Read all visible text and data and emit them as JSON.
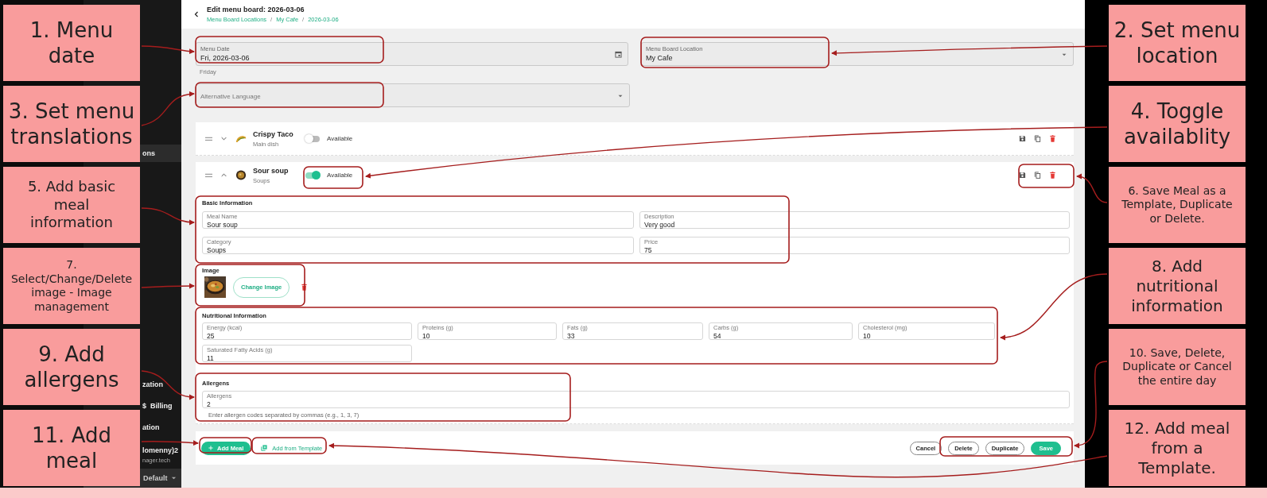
{
  "left_notes": [
    {
      "text": "1. Menu\ndate"
    },
    {
      "text": "3. Set menu\ntranslations"
    },
    {
      "text": "5. Add basic\nmeal\ninformation"
    },
    {
      "text": "7.\nSelect/Change/Delete\nimage - Image\nmanagement"
    },
    {
      "text": "9. Add\nallergens"
    },
    {
      "text": "11. Add\nmeal"
    }
  ],
  "right_notes": [
    {
      "text": "2. Set menu\nlocation"
    },
    {
      "text": "4. Toggle\navailablity"
    },
    {
      "text": "6. Save Meal as a\nTemplate, Duplicate\nor Delete."
    },
    {
      "text": "8. Add\nnutritional\ninformation"
    },
    {
      "text": "10. Save, Delete,\nDuplicate or Cancel\nthe entire day"
    },
    {
      "text": "12. Add meal\nfrom a\nTemplate."
    }
  ],
  "sidebar": {
    "items": [
      {
        "label": "ons",
        "selected": true
      },
      {
        "label": "zation",
        "selected": false
      },
      {
        "icon_text": "$",
        "label": "Billing",
        "selected": false
      },
      {
        "label": "ation",
        "selected": false
      }
    ],
    "account": {
      "name": "lomenny)2",
      "email": "nager.tech"
    },
    "workspace_select": {
      "value": "Default"
    }
  },
  "header": {
    "title": "Edit menu board: 2026-03-06",
    "breadcrumbs": [
      "Menu Board Locations",
      "My Cafe",
      "2026-03-06"
    ],
    "separator": "/"
  },
  "form": {
    "menu_date": {
      "label": "Menu Date",
      "value": "Fri, 2026-03-06",
      "hint": "Friday"
    },
    "location": {
      "label": "Menu Board Location",
      "value": "My Cafe"
    },
    "alternative_language": {
      "placeholder": "Alternative Language"
    }
  },
  "meals": [
    {
      "name": "Crispy Taco",
      "category": "Main dish",
      "availability_label": "Available",
      "available": false,
      "expanded": false
    },
    {
      "name": "Sour soup",
      "category": "Soups",
      "availability_label": "Available",
      "available": true,
      "expanded": true,
      "details": {
        "basic_title": "Basic Information",
        "basic_fields": [
          {
            "label": "Meal Name",
            "value": "Sour soup"
          },
          {
            "label": "Description",
            "value": "Very good"
          },
          {
            "label": "Category",
            "value": "Soups"
          },
          {
            "label": "Price",
            "value": "75"
          }
        ],
        "image_title": "Image",
        "change_image": "Change Image",
        "nutrition_title": "Nutritional Information",
        "nutrition_fields": [
          {
            "label": "Energy (kcal)",
            "value": "25"
          },
          {
            "label": "Proteins (g)",
            "value": "10"
          },
          {
            "label": "Fats (g)",
            "value": "33"
          },
          {
            "label": "Carbs (g)",
            "value": "54"
          },
          {
            "label": "Cholesterol (mg)",
            "value": "10"
          },
          {
            "label": "Saturated Fatty Acids (g)",
            "value": "11"
          }
        ],
        "allergens_title": "Allergens",
        "allergens_field": {
          "label": "Allergens",
          "value": "2",
          "hint": "Enter allergen codes separated by commas (e.g., 1, 3, 7)"
        }
      }
    }
  ],
  "actions": {
    "add_meal": "Add Meal",
    "add_from_template": "Add from Template",
    "day_buttons": [
      {
        "label": "Cancel",
        "kind": "outline"
      },
      {
        "label": "Delete",
        "kind": "outline"
      },
      {
        "label": "Duplicate",
        "kind": "outline"
      },
      {
        "label": "Save",
        "kind": "primary"
      }
    ]
  }
}
